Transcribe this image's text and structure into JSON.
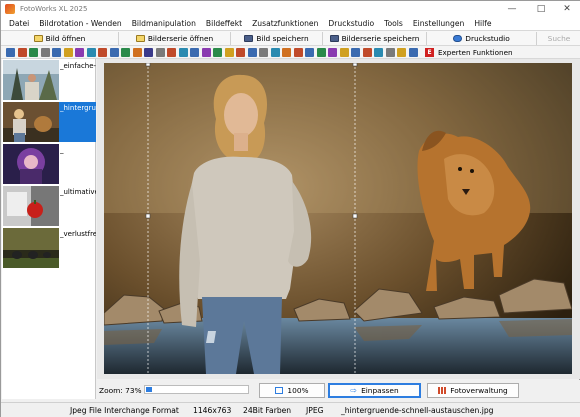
{
  "window": {
    "title": "FotoWorks XL 2025"
  },
  "menu": [
    "Datei",
    "Bildrotation - Wenden",
    "Bildmanipulation",
    "Bildeffekt",
    "Zusatzfunktionen",
    "Druckstudio",
    "Tools",
    "Einstellungen",
    "Hilfe"
  ],
  "toolbar": {
    "open": "Bild öffnen",
    "series_open": "Bilderserie öffnen",
    "save": "Bild speichern",
    "series_save": "Bilderserie speichern",
    "print": "Druckstudio",
    "disabled": "Suche",
    "expert": "Experten Funktionen"
  },
  "thumbnails": [
    {
      "label": "_einfache-",
      "selected": false
    },
    {
      "label": "_hintergrue",
      "selected": true
    },
    {
      "label": "_",
      "selected": false
    },
    {
      "label": "_ultimative",
      "selected": false
    },
    {
      "label": "_verlustfre",
      "selected": false
    }
  ],
  "zoom": {
    "label": "Zoom: 73%",
    "level_percent": 73,
    "btn_100": "100%",
    "btn_fit": "Einpassen",
    "btn_manage": "Fotoverwaltung"
  },
  "status": {
    "format": "Jpeg File Interchange Format",
    "dimensions": "1146x763",
    "colors": "24Bit Farben",
    "type": "JPEG",
    "filename": "_hintergruende-schnell-austauschen.jpg"
  }
}
